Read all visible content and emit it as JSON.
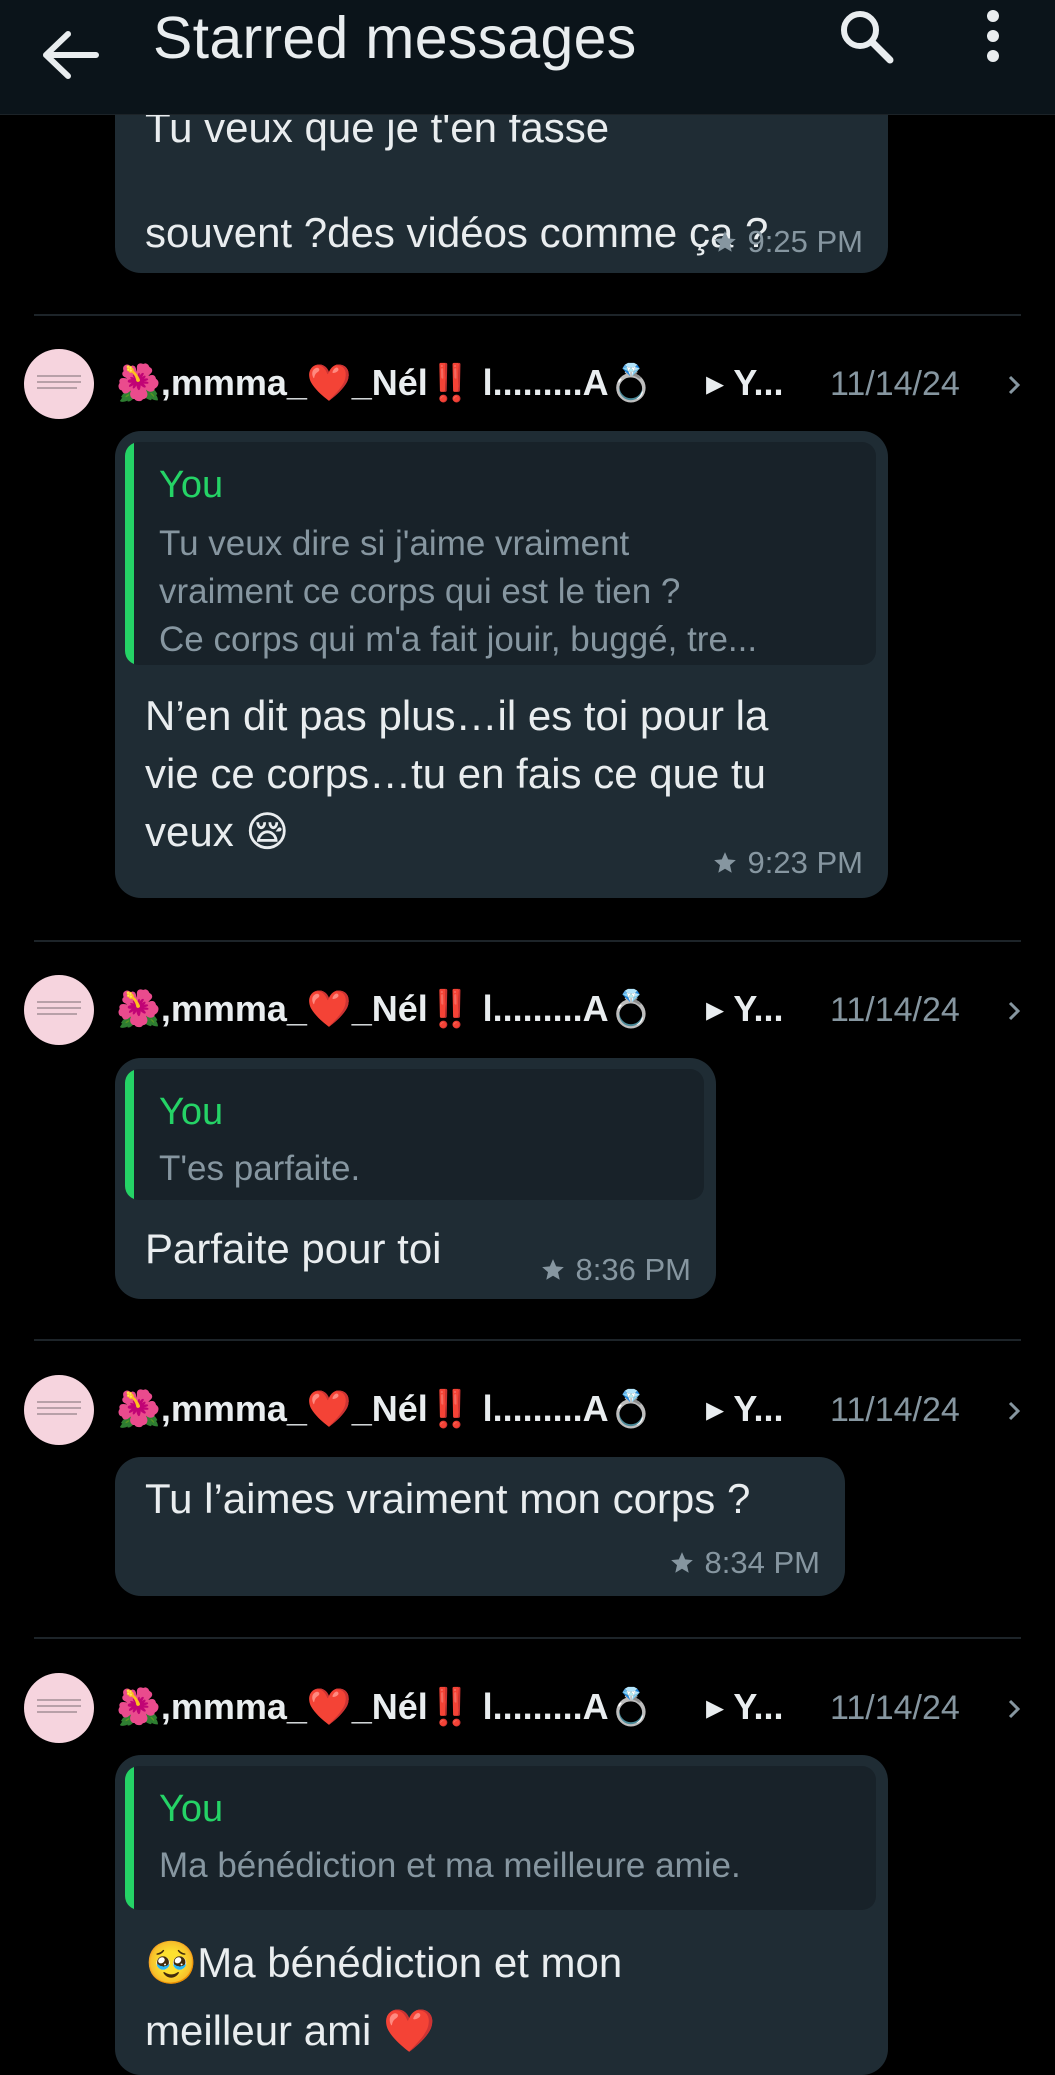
{
  "header": {
    "title": "Starred messages",
    "back_icon": "arrow-back-icon",
    "search_icon": "search-icon",
    "menu_icon": "more-vert-icon"
  },
  "colors": {
    "background": "#000000",
    "header": "#0b141a",
    "bubble": "#1f2c34",
    "quote_bg": "#182229",
    "accent": "#25d366",
    "secondary_text": "#8696a0"
  },
  "top_message": {
    "text_partial": "Tu veux que je t'en fasse",
    "text": "souvent ?des vidéos comme ça ?",
    "time": "9:25 PM"
  },
  "items": [
    {
      "sender": "🌺,mmma_❤️_Nél‼️ l.........A💍",
      "recipient": "▸ Y...",
      "date": "11/14/24",
      "quote": {
        "author": "You",
        "text": "Tu veux dire si j'aime vraiment\nvraiment ce corps qui est le tien ?\nCe corps qui m'a fait jouir, buggé, tre..."
      },
      "text": "N’en dit pas plus…il es toi pour la\nvie ce corps…tu en fais ce que tu\nveux 😪",
      "time": "9:23 PM"
    },
    {
      "sender": "🌺,mmma_❤️_Nél‼️ l.........A💍",
      "recipient": "▸ Y...",
      "date": "11/14/24",
      "quote": {
        "author": "You",
        "text": "T'es parfaite."
      },
      "text": "Parfaite pour toi",
      "time": "8:36 PM"
    },
    {
      "sender": "🌺,mmma_❤️_Nél‼️ l.........A💍",
      "recipient": "▸ Y...",
      "date": "11/14/24",
      "text": "Tu l’aimes vraiment mon corps ?",
      "time": "8:34 PM"
    },
    {
      "sender": "🌺,mmma_❤️_Nél‼️ l.........A💍",
      "recipient": "▸ Y...",
      "date": "11/14/24",
      "quote": {
        "author": "You",
        "text": "Ma bénédiction et ma meilleure amie."
      },
      "text": "🥹Ma bénédiction et mon\nmeilleur ami ❤️"
    }
  ]
}
